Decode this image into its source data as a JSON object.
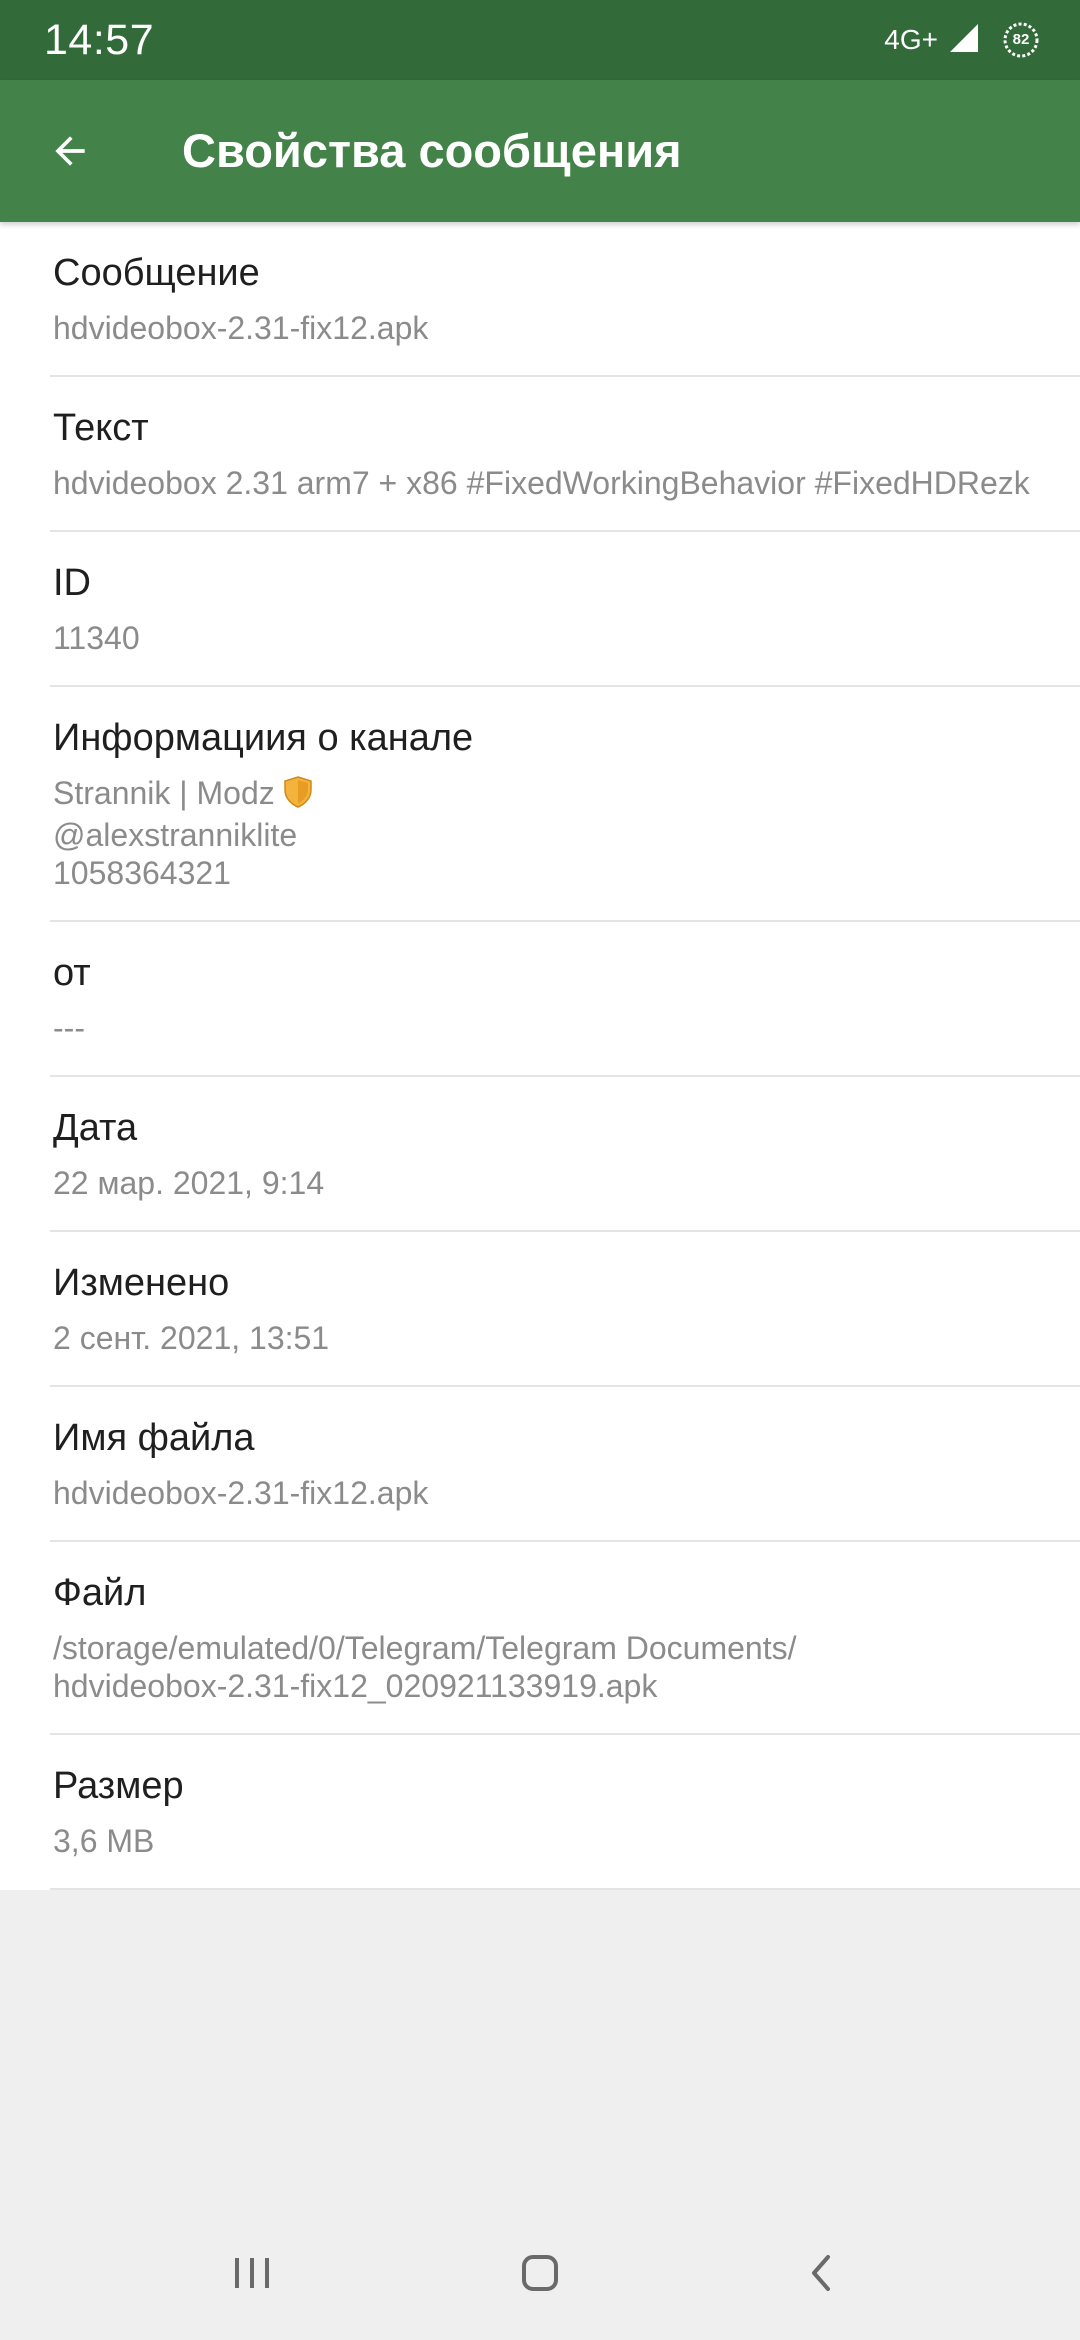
{
  "status_bar": {
    "time": "14:57",
    "network": "4G+",
    "battery": "82"
  },
  "app_bar": {
    "title": "Свойства сообщения",
    "back_icon": "arrow-left-icon"
  },
  "properties": [
    {
      "label": "Сообщение",
      "value": "hdvideobox-2.31-fix12.apk"
    },
    {
      "label": "Текст",
      "value": "hdvideobox 2.31 arm7 + x86  #FixedWorkingBehavior #FixedHDRezk"
    },
    {
      "label": "ID",
      "value": "11340"
    },
    {
      "label": "Информациия о канале",
      "channel_name": "Strannik | Modz",
      "channel_icon": "shield-icon",
      "channel_username": "@alexstranniklite",
      "channel_id": "1058364321"
    },
    {
      "label": "от",
      "value": "---"
    },
    {
      "label": "Дата",
      "value": "22 мар. 2021, 9:14"
    },
    {
      "label": "Изменено",
      "value": "2 сент. 2021, 13:51"
    },
    {
      "label": "Имя файла",
      "value": "hdvideobox-2.31-fix12.apk"
    },
    {
      "label": "Файл",
      "path_line1": "/storage/emulated/0/Telegram/Telegram Documents/",
      "path_line2": "hdvideobox-2.31-fix12_020921133919.apk"
    },
    {
      "label": "Размер",
      "value": "3,6 MB"
    }
  ],
  "nav_bar": {
    "recents_icon": "recents-icon",
    "home_icon": "home-icon",
    "back_icon": "back-icon"
  },
  "colors": {
    "status_bar": "#336a39",
    "app_bar": "#438349",
    "label": "#1f1f1f",
    "value": "#8b8b8b",
    "divider": "#e4e4e4",
    "background": "#efefef"
  }
}
